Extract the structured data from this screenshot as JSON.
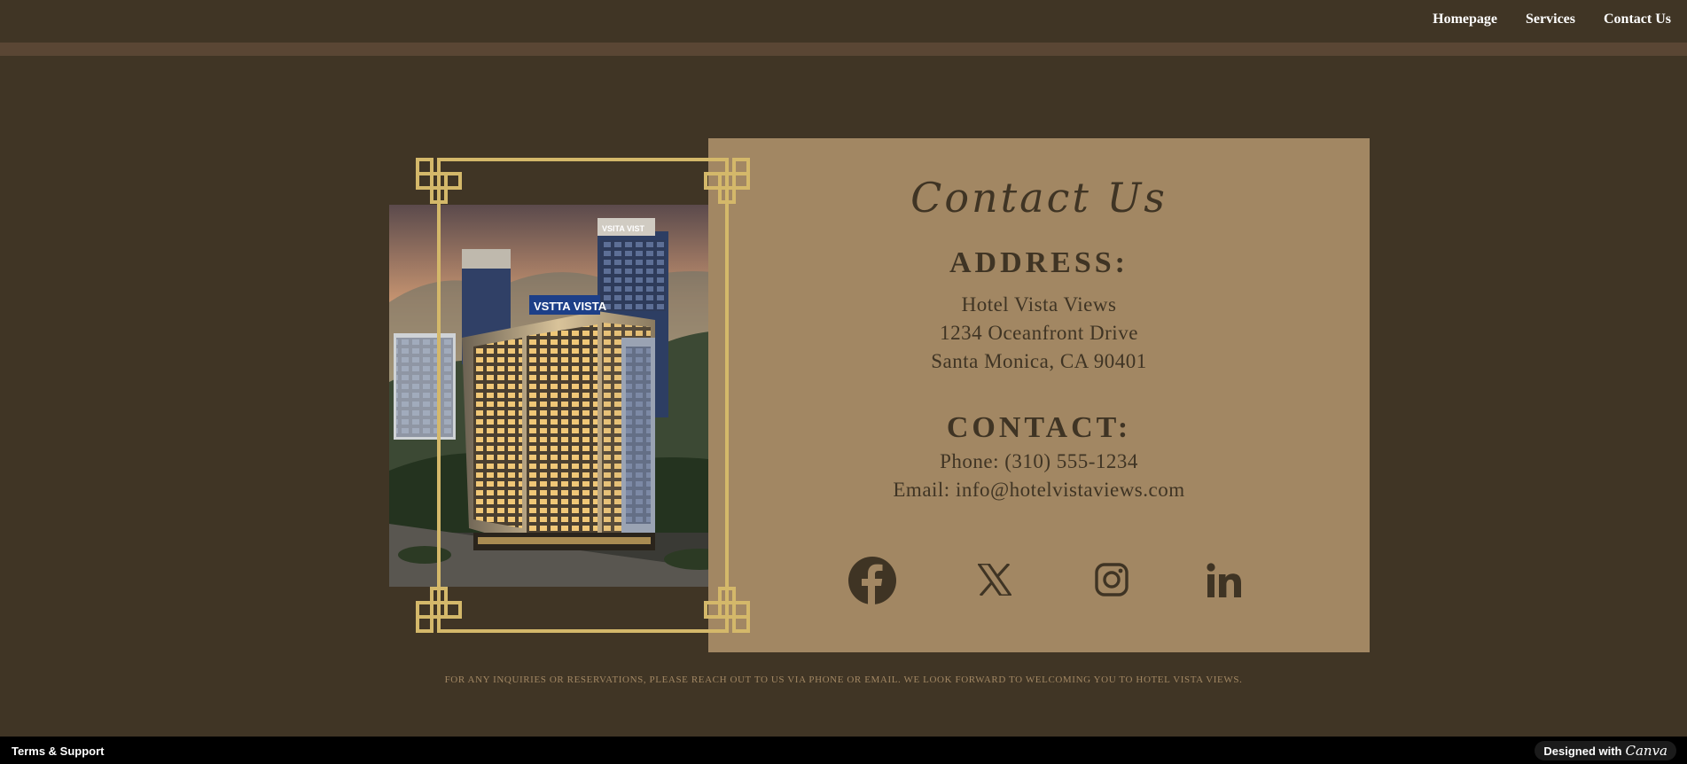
{
  "nav": {
    "items": [
      {
        "label": "Homepage"
      },
      {
        "label": "Services"
      },
      {
        "label": "Contact Us"
      }
    ]
  },
  "photo": {
    "sign_top": "VSTTA VISTA",
    "sign_small": "VSITA VIST"
  },
  "contact": {
    "title": "Contact Us",
    "address_heading": "ADDRESS:",
    "address_lines": [
      "Hotel Vista Views",
      "1234 Oceanfront Drive",
      "Santa Monica, CA 90401"
    ],
    "contact_heading": "CONTACT:",
    "phone": "Phone: (310) 555-1234",
    "email": "Email: info@hotelvistaviews.com",
    "socials": [
      "facebook-icon",
      "x-icon",
      "instagram-icon",
      "linkedin-icon"
    ]
  },
  "footnote": "FOR ANY INQUIRIES OR RESERVATIONS, PLEASE REACH OUT TO US VIA PHONE OR EMAIL. WE LOOK FORWARD TO WELCOMING YOU TO HOTEL VISTA VIEWS.",
  "footer": {
    "terms": "Terms & Support",
    "designed_with": "Designed with",
    "brand": "Canva"
  },
  "colors": {
    "background": "#403525",
    "band": "#5a4634",
    "card": "#a28763",
    "text_dark": "#3f3424",
    "frame_gold": "#d4b86a"
  }
}
